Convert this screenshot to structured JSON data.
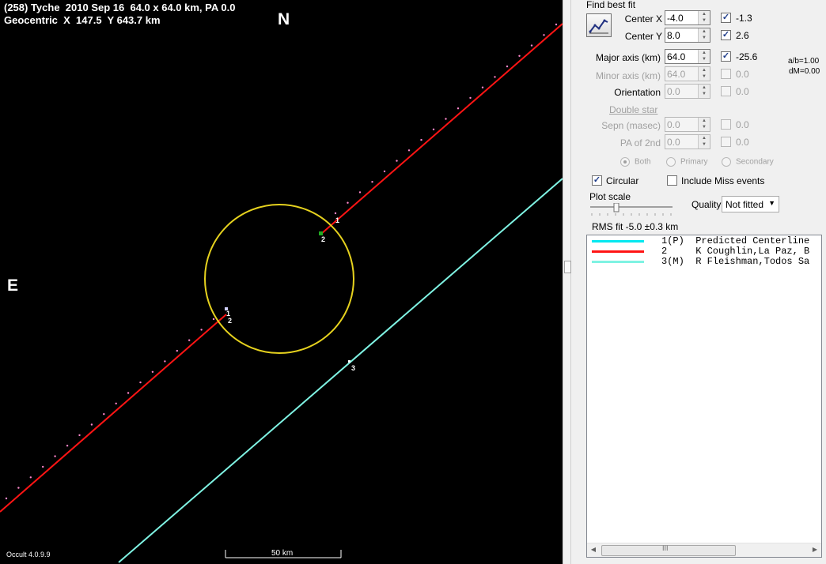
{
  "plot": {
    "title_line1": "(258) Tyche  2010 Sep 16  64.0 x 64.0 km, PA 0.0",
    "title_line2": "Geocentric  X  147.5  Y 643.7 km",
    "north_label": "N",
    "east_label": "E",
    "version": "Occult 4.0.9.9",
    "scale_label": "50 km",
    "chord_labels": {
      "a": "1",
      "b": "2",
      "c": "1",
      "d": "2",
      "e": "3"
    },
    "colors": {
      "background": "#000000",
      "outline": "#e6d21e",
      "chord": "#ff1414",
      "miss": "#7ff3e3",
      "dots": "#ff88cc"
    }
  },
  "panel": {
    "section_title": "Find best fit",
    "fit_icon": "best-fit-chart-icon",
    "center_x": {
      "label": "Center X",
      "value": "-4.0",
      "checked": true,
      "result": "-1.3"
    },
    "center_y": {
      "label": "Center Y",
      "value": "8.0",
      "checked": true,
      "result": "2.6"
    },
    "major_axis": {
      "label": "Major axis (km)",
      "value": "64.0",
      "checked": true,
      "result": "-25.6"
    },
    "minor_axis": {
      "label": "Minor axis (km)",
      "value": "64.0",
      "checked": false,
      "result": "0.0"
    },
    "orientation": {
      "label": "Orientation",
      "value": "0.0",
      "checked": false,
      "result": "0.0"
    },
    "ratio_ab": "a/b=1.00",
    "ratio_dm": "dM=0.00",
    "double_star_link": "Double star",
    "sepn": {
      "label": "Sepn (masec)",
      "value": "0.0",
      "checked": false,
      "result": "0.0"
    },
    "pa2": {
      "label": "PA of 2nd",
      "value": "0.0",
      "checked": false,
      "result": "0.0"
    },
    "radios": {
      "both": "Both",
      "primary": "Primary",
      "secondary": "Secondary"
    },
    "circular": {
      "label": "Circular",
      "checked": true
    },
    "include_miss": {
      "label": "Include Miss events",
      "checked": false
    },
    "plot_scale_label": "Plot scale",
    "quality_label": "Quality",
    "quality_value": "Not fitted",
    "rms_fit": "RMS fit -5.0 ±0.3 km",
    "legend": [
      {
        "text": "1(P)  Predicted Centerline",
        "color": "#00e8f0"
      },
      {
        "text": "2     K Coughlin,La Paz, B",
        "color": "#ff1414"
      },
      {
        "text": "3(M)  R Fleishman,Todos Sa",
        "color": "#7ff3e3"
      }
    ],
    "scrollbar": {
      "thumb_glyph": "III"
    }
  }
}
